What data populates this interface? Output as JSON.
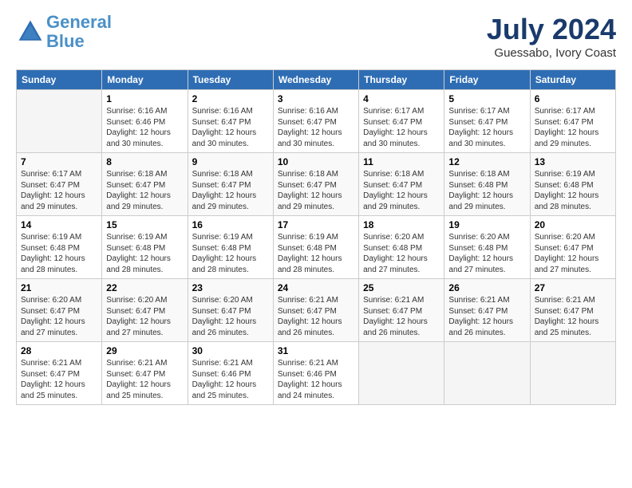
{
  "header": {
    "logo_line1": "General",
    "logo_line2": "Blue",
    "month": "July 2024",
    "location": "Guessabo, Ivory Coast"
  },
  "weekdays": [
    "Sunday",
    "Monday",
    "Tuesday",
    "Wednesday",
    "Thursday",
    "Friday",
    "Saturday"
  ],
  "weeks": [
    [
      {
        "day": "",
        "info": ""
      },
      {
        "day": "1",
        "info": "Sunrise: 6:16 AM\nSunset: 6:46 PM\nDaylight: 12 hours\nand 30 minutes."
      },
      {
        "day": "2",
        "info": "Sunrise: 6:16 AM\nSunset: 6:47 PM\nDaylight: 12 hours\nand 30 minutes."
      },
      {
        "day": "3",
        "info": "Sunrise: 6:16 AM\nSunset: 6:47 PM\nDaylight: 12 hours\nand 30 minutes."
      },
      {
        "day": "4",
        "info": "Sunrise: 6:17 AM\nSunset: 6:47 PM\nDaylight: 12 hours\nand 30 minutes."
      },
      {
        "day": "5",
        "info": "Sunrise: 6:17 AM\nSunset: 6:47 PM\nDaylight: 12 hours\nand 30 minutes."
      },
      {
        "day": "6",
        "info": "Sunrise: 6:17 AM\nSunset: 6:47 PM\nDaylight: 12 hours\nand 29 minutes."
      }
    ],
    [
      {
        "day": "7",
        "info": "Sunrise: 6:17 AM\nSunset: 6:47 PM\nDaylight: 12 hours\nand 29 minutes."
      },
      {
        "day": "8",
        "info": "Sunrise: 6:18 AM\nSunset: 6:47 PM\nDaylight: 12 hours\nand 29 minutes."
      },
      {
        "day": "9",
        "info": "Sunrise: 6:18 AM\nSunset: 6:47 PM\nDaylight: 12 hours\nand 29 minutes."
      },
      {
        "day": "10",
        "info": "Sunrise: 6:18 AM\nSunset: 6:47 PM\nDaylight: 12 hours\nand 29 minutes."
      },
      {
        "day": "11",
        "info": "Sunrise: 6:18 AM\nSunset: 6:47 PM\nDaylight: 12 hours\nand 29 minutes."
      },
      {
        "day": "12",
        "info": "Sunrise: 6:18 AM\nSunset: 6:48 PM\nDaylight: 12 hours\nand 29 minutes."
      },
      {
        "day": "13",
        "info": "Sunrise: 6:19 AM\nSunset: 6:48 PM\nDaylight: 12 hours\nand 28 minutes."
      }
    ],
    [
      {
        "day": "14",
        "info": "Sunrise: 6:19 AM\nSunset: 6:48 PM\nDaylight: 12 hours\nand 28 minutes."
      },
      {
        "day": "15",
        "info": "Sunrise: 6:19 AM\nSunset: 6:48 PM\nDaylight: 12 hours\nand 28 minutes."
      },
      {
        "day": "16",
        "info": "Sunrise: 6:19 AM\nSunset: 6:48 PM\nDaylight: 12 hours\nand 28 minutes."
      },
      {
        "day": "17",
        "info": "Sunrise: 6:19 AM\nSunset: 6:48 PM\nDaylight: 12 hours\nand 28 minutes."
      },
      {
        "day": "18",
        "info": "Sunrise: 6:20 AM\nSunset: 6:48 PM\nDaylight: 12 hours\nand 27 minutes."
      },
      {
        "day": "19",
        "info": "Sunrise: 6:20 AM\nSunset: 6:48 PM\nDaylight: 12 hours\nand 27 minutes."
      },
      {
        "day": "20",
        "info": "Sunrise: 6:20 AM\nSunset: 6:47 PM\nDaylight: 12 hours\nand 27 minutes."
      }
    ],
    [
      {
        "day": "21",
        "info": "Sunrise: 6:20 AM\nSunset: 6:47 PM\nDaylight: 12 hours\nand 27 minutes."
      },
      {
        "day": "22",
        "info": "Sunrise: 6:20 AM\nSunset: 6:47 PM\nDaylight: 12 hours\nand 27 minutes."
      },
      {
        "day": "23",
        "info": "Sunrise: 6:20 AM\nSunset: 6:47 PM\nDaylight: 12 hours\nand 26 minutes."
      },
      {
        "day": "24",
        "info": "Sunrise: 6:21 AM\nSunset: 6:47 PM\nDaylight: 12 hours\nand 26 minutes."
      },
      {
        "day": "25",
        "info": "Sunrise: 6:21 AM\nSunset: 6:47 PM\nDaylight: 12 hours\nand 26 minutes."
      },
      {
        "day": "26",
        "info": "Sunrise: 6:21 AM\nSunset: 6:47 PM\nDaylight: 12 hours\nand 26 minutes."
      },
      {
        "day": "27",
        "info": "Sunrise: 6:21 AM\nSunset: 6:47 PM\nDaylight: 12 hours\nand 25 minutes."
      }
    ],
    [
      {
        "day": "28",
        "info": "Sunrise: 6:21 AM\nSunset: 6:47 PM\nDaylight: 12 hours\nand 25 minutes."
      },
      {
        "day": "29",
        "info": "Sunrise: 6:21 AM\nSunset: 6:47 PM\nDaylight: 12 hours\nand 25 minutes."
      },
      {
        "day": "30",
        "info": "Sunrise: 6:21 AM\nSunset: 6:46 PM\nDaylight: 12 hours\nand 25 minutes."
      },
      {
        "day": "31",
        "info": "Sunrise: 6:21 AM\nSunset: 6:46 PM\nDaylight: 12 hours\nand 24 minutes."
      },
      {
        "day": "",
        "info": ""
      },
      {
        "day": "",
        "info": ""
      },
      {
        "day": "",
        "info": ""
      }
    ]
  ]
}
